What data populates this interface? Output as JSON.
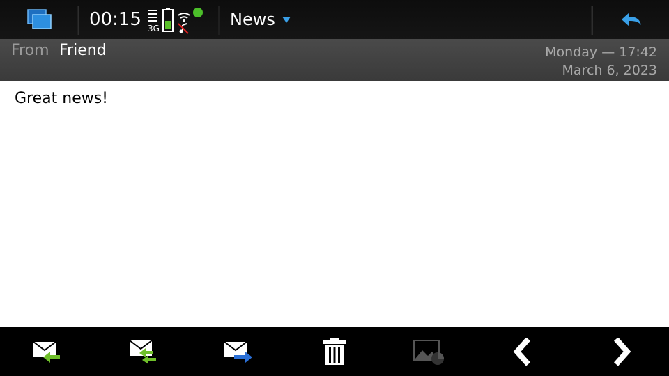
{
  "status_bar": {
    "time": "00:15",
    "network_label": "3G"
  },
  "app": {
    "title": "News"
  },
  "message": {
    "from_label": "From",
    "from_name": "Friend",
    "day_time": "Monday — 17:42",
    "date": "March  6, 2023",
    "body": "Great news!"
  },
  "icons": {
    "task_switcher": "task-switcher-icon",
    "back": "back-arrow-icon",
    "reply": "reply-icon",
    "reply_all": "reply-all-icon",
    "forward": "forward-icon",
    "delete": "trash-icon",
    "images": "image-icon",
    "previous": "chevron-left-icon",
    "next": "chevron-right-icon"
  },
  "colors": {
    "accent_blue": "#3aa0e8",
    "reply_green": "#6fbf2a",
    "forward_blue": "#2a6fd6"
  }
}
